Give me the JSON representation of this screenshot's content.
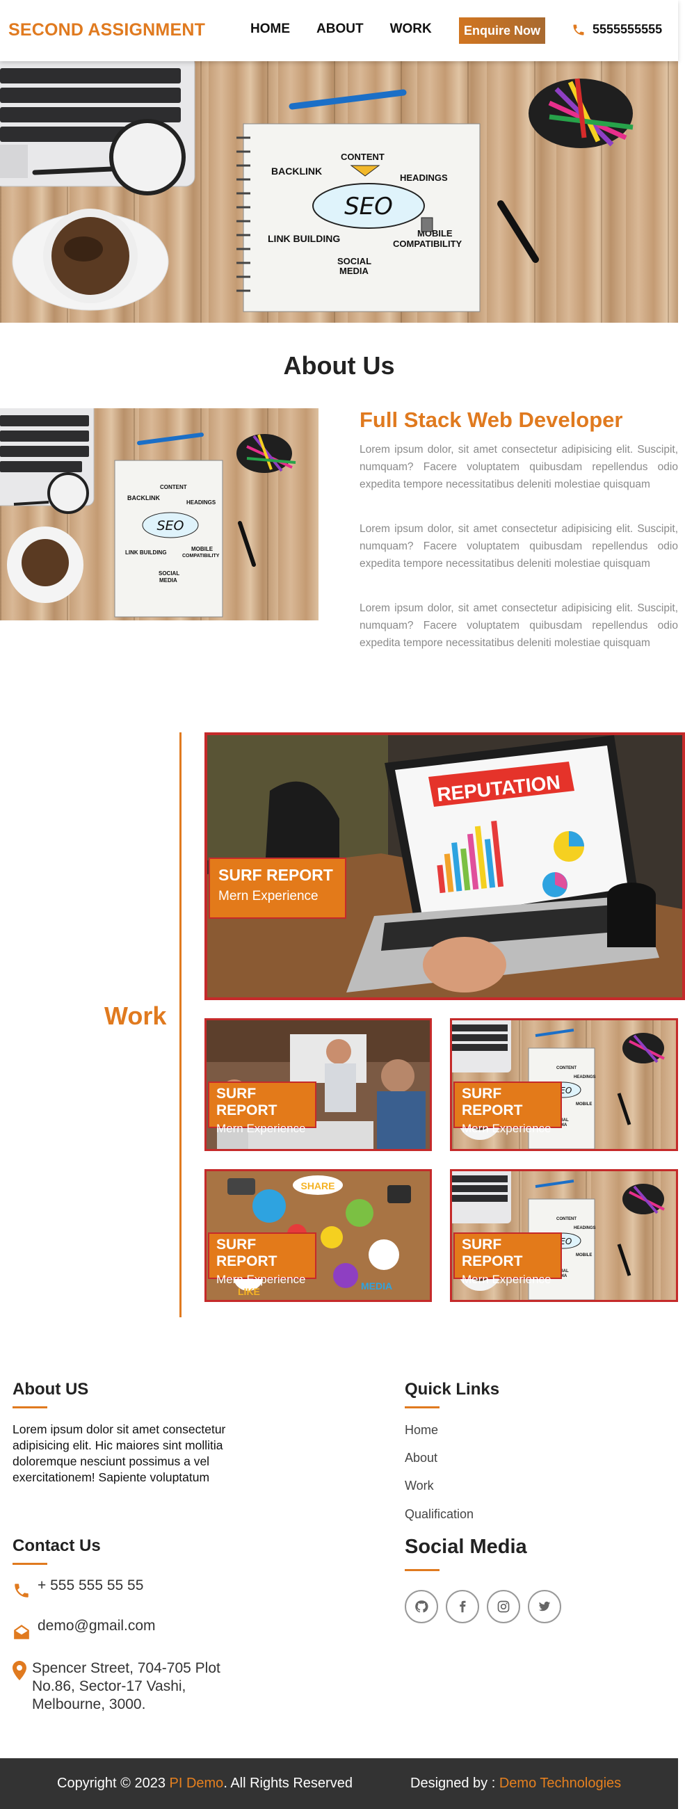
{
  "header": {
    "brand": "SECOND ASSIGNMENT",
    "nav": [
      "HOME",
      "ABOUT",
      "WORK"
    ],
    "enquire": "Enquire Now",
    "phone": "5555555555"
  },
  "hero": {
    "notebook_words": [
      "CONTENT",
      "BACKLINK",
      "HEADINGS",
      "SEO",
      "LINK BUILDING",
      "MOBILE",
      "COMPATIBILITY",
      "SOCIAL",
      "MEDIA"
    ]
  },
  "about": {
    "title": "About Us",
    "heading": "Full Stack Web Developer",
    "paragraphs": [
      "Lorem ipsum dolor, sit amet consectetur adipisicing elit. Suscipit, numquam? Facere voluptatem quibusdam repellendus odio expedita tempore necessitatibus deleniti molestiae quisquam",
      "Lorem ipsum dolor, sit amet consectetur adipisicing elit. Suscipit, numquam? Facere voluptatem quibusdam repellendus odio expedita tempore necessitatibus deleniti molestiae quisquam",
      "Lorem ipsum dolor, sit amet consectetur adipisicing elit. Suscipit, numquam? Facere voluptatem quibusdam repellendus odio expedita tempore necessitatibus deleniti molestiae quisquam"
    ]
  },
  "work": {
    "title": "Work",
    "big_tile_banner": "REPUTATION",
    "share_word": "SHARE",
    "like_word": "LIKE",
    "media_word": "MEDIA",
    "tiles": [
      {
        "title": "SURF REPORT",
        "subtitle": "Mern Experience"
      },
      {
        "title": "SURF REPORT",
        "subtitle": "Mern Experience"
      },
      {
        "title": "SURF REPORT",
        "subtitle": "Mern Experience"
      },
      {
        "title": "SURF REPORT",
        "subtitle": "Mern Experience"
      },
      {
        "title": "SURF REPORT",
        "subtitle": "Mern Experience"
      }
    ]
  },
  "footer": {
    "about_title": "About US",
    "about_text": "Lorem ipsum dolor sit amet consectetur adipisicing elit. Hic maiores sint mollitia doloremque nesciunt possimus a vel exercitationem! Sapiente voluptatum",
    "quick_title": "Quick Links",
    "quick_links": [
      "Home",
      "About",
      "Work",
      "Qualification"
    ],
    "contact_title": "Contact Us",
    "contact_phone": "+ 555 555 55 55",
    "contact_email": "demo@gmail.com",
    "contact_address": "Spencer Street, 704-705 Plot No.86, Sector-17 Vashi, Melbourne, 3000.",
    "social_title": "Social Media",
    "social_icons": [
      "github-icon",
      "facebook-icon",
      "instagram-icon",
      "twitter-icon"
    ]
  },
  "bottom": {
    "copyright_pre": "Copyright © 2023 ",
    "copyright_brand": "PI Demo",
    "copyright_post": ". All Rights Reserved",
    "designed_pre": "Designed by : ",
    "designed_brand": "Demo Technologies"
  },
  "colors": {
    "accent": "#e07a1f",
    "tile_border": "#c52a2a",
    "footer_bg": "#333333"
  }
}
